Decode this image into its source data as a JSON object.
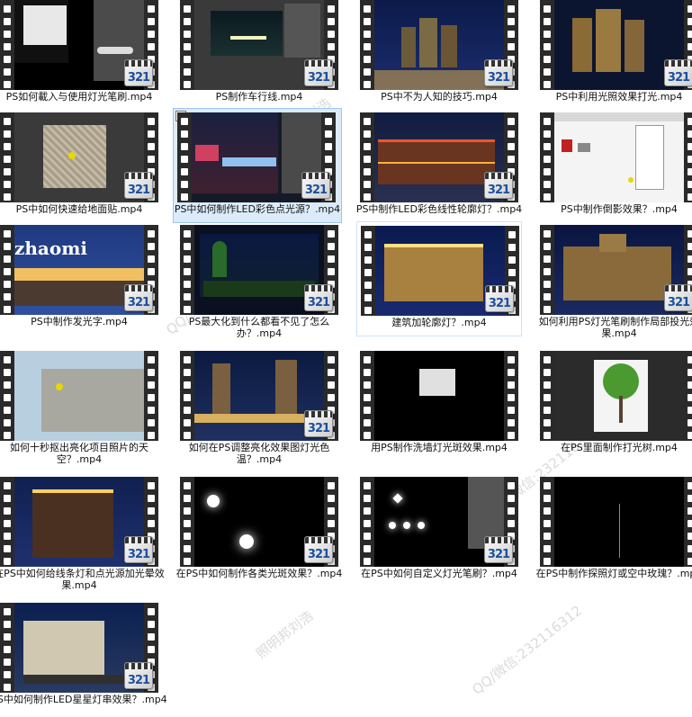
{
  "files": [
    {
      "name": "PS如何載入与使用灯光笔刷.mp4",
      "badge": "321"
    },
    {
      "name": "PS制作车行线.mp4",
      "badge": "321"
    },
    {
      "name": "PS中不为人知的技巧.mp4",
      "badge": "321"
    },
    {
      "name": "PS中利用光照效果打光.mp4",
      "badge": "321"
    },
    {
      "name": "PS中如何快速给地面贴.mp4",
      "badge": "321"
    },
    {
      "name": "PS中如何制作LED彩色点光源？.mp4",
      "badge": "321"
    },
    {
      "name": "PS中制作LED彩色线性轮廓灯？.mp4",
      "badge": "321"
    },
    {
      "name": "PS中制作倒影效果？.mp4",
      "badge": "321"
    },
    {
      "name": "PS中制作发光字.mp4",
      "badge": "321",
      "sign": "zhaomi"
    },
    {
      "name": "PS最大化到什么都看不见了怎么办？.mp4",
      "badge": "321"
    },
    {
      "name": "建筑加轮廓灯？.mp4",
      "badge": "321"
    },
    {
      "name": "如何利用PS灯光笔刷制作局部投光效果.mp4",
      "badge": "321"
    },
    {
      "name": "如何十秒抠出亮化项目照片的天空？.mp4",
      "badge": "321"
    },
    {
      "name": "如何在PS调整亮化效果图灯光色温？.mp4",
      "badge": "321"
    },
    {
      "name": "用PS制作洗墙灯光斑效果.mp4",
      "badge": "321"
    },
    {
      "name": "在PS里面制作打光树.mp4",
      "badge": "321"
    },
    {
      "name": "在PS中如何给线条灯和点光源加光晕效果.mp4",
      "badge": "321"
    },
    {
      "name": "在PS中如何制作各类光斑效果？.mp4",
      "badge": "321"
    },
    {
      "name": "在PS中如何自定义灯光笔刷？.mp4",
      "badge": "321"
    },
    {
      "name": "在PS中制作探照灯或空中玫瑰？.mp4",
      "badge": "321"
    },
    {
      "name": "PS中如何制作LED星星灯串效果？.mp4",
      "badge": "321"
    }
  ],
  "watermarks": [
    "照明邦刘浩",
    "QQ/微信:232116312",
    "QQ/微信:2321163128",
    "照明邦刘浩",
    "QQ/微信:232116312"
  ]
}
